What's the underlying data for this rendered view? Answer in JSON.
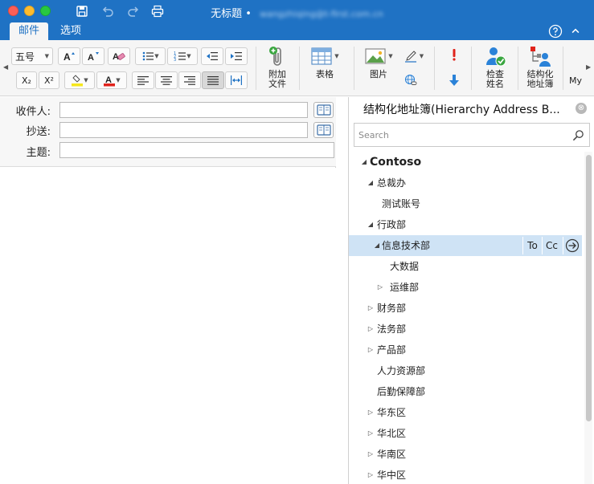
{
  "window": {
    "title": "无标题",
    "title_separator": "•",
    "title_account": "wangzhiqing@t-first.com.cn"
  },
  "tabs": [
    {
      "label": "邮件",
      "active": true
    },
    {
      "label": "选项",
      "active": false
    }
  ],
  "ribbon": {
    "font_size_value": "五号",
    "subscript_label": "X₂",
    "superscript_label": "X²",
    "attach_label": "附加\n文件",
    "table_label": "表格",
    "picture_label": "图片",
    "check_names_label": "检查\n姓名",
    "hierarchy_label": "结构化\n地址簿",
    "my_label": "My"
  },
  "compose": {
    "to_label": "收件人:",
    "cc_label": "抄送:",
    "subject_label": "主题:",
    "to_value": "",
    "cc_value": "",
    "subject_value": ""
  },
  "panel": {
    "title": "结构化地址簿(Hierarchy Address B...",
    "close_icon": "⊗",
    "search_placeholder": "Search",
    "to_label": "To",
    "cc_label": "Cc",
    "tree": [
      {
        "label": "Contoso",
        "level": 0,
        "toggle": "expanded",
        "root": true
      },
      {
        "label": "总裁办",
        "level": 1,
        "toggle": "expanded"
      },
      {
        "label": "测试账号",
        "level": 2,
        "toggle": "none"
      },
      {
        "label": "行政部",
        "level": 1,
        "toggle": "expanded"
      },
      {
        "label": "信息技术部",
        "level": 1,
        "toggle": "expanded",
        "selected": true
      },
      {
        "label": "大数据",
        "level": 3,
        "toggle": "none"
      },
      {
        "label": "运维部",
        "level": 2,
        "toggle": "collapsed"
      },
      {
        "label": "财务部",
        "level": 1,
        "toggle": "collapsed"
      },
      {
        "label": "法务部",
        "level": 1,
        "toggle": "collapsed"
      },
      {
        "label": "产品部",
        "level": 1,
        "toggle": "collapsed"
      },
      {
        "label": "人力资源部",
        "level": 1,
        "toggle": "none"
      },
      {
        "label": "后勤保障部",
        "level": 1,
        "toggle": "none"
      },
      {
        "label": "华东区",
        "level": 1,
        "toggle": "collapsed"
      },
      {
        "label": "华北区",
        "level": 1,
        "toggle": "collapsed"
      },
      {
        "label": "华南区",
        "level": 1,
        "toggle": "collapsed"
      },
      {
        "label": "华中区",
        "level": 1,
        "toggle": "collapsed"
      }
    ]
  },
  "colors": {
    "titlebar": "#1f72c4",
    "selection": "#cfe3f5",
    "highlight_yellow": "#f6e71b",
    "font_red": "#e0231b",
    "priority_red": "#e0231b",
    "priority_blue": "#2a82d8"
  }
}
